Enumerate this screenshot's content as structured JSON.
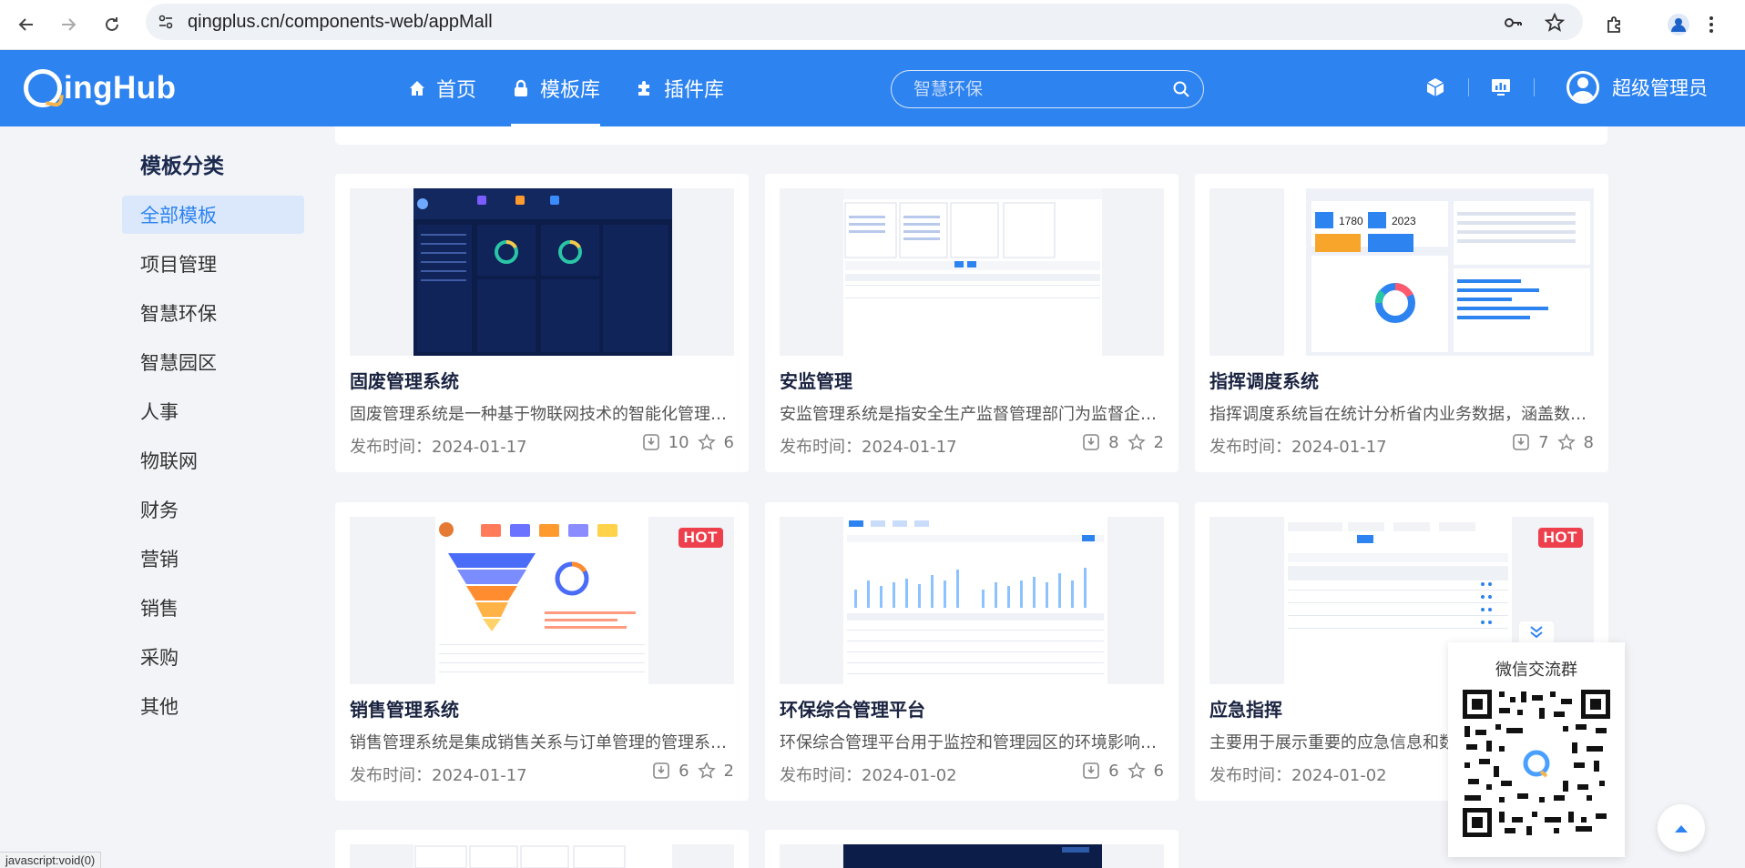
{
  "browser": {
    "url": "qingplus.cn/components-web/appMall"
  },
  "app": {
    "logo_text": "ingHub",
    "nav": [
      {
        "label": "首页",
        "icon": "home-icon"
      },
      {
        "label": "模板库",
        "icon": "lock-icon",
        "active": true
      },
      {
        "label": "插件库",
        "icon": "puzzle-icon"
      }
    ],
    "search_placeholder": "智慧环保",
    "username": "超级管理员"
  },
  "sidebar": {
    "title": "模板分类",
    "items": [
      {
        "label": "全部模板",
        "active": true
      },
      {
        "label": "项目管理"
      },
      {
        "label": "智慧环保"
      },
      {
        "label": "智慧园区"
      },
      {
        "label": "人事"
      },
      {
        "label": "物联网"
      },
      {
        "label": "财务"
      },
      {
        "label": "营销"
      },
      {
        "label": "销售"
      },
      {
        "label": "采购"
      },
      {
        "label": "其他"
      }
    ]
  },
  "cards": [
    {
      "title": "固废管理系统",
      "desc": "固废管理系统是一种基于物联网技术的智能化管理系统",
      "date": "发布时间：2024-01-17",
      "downloads": "10",
      "stars": "6",
      "hot": false,
      "theme": "dark"
    },
    {
      "title": "安监管理",
      "desc": "安监管理系统是指安全生产监督管理部门为监督企业安全生产",
      "date": "发布时间：2024-01-17",
      "downloads": "8",
      "stars": "2",
      "hot": false,
      "theme": "form"
    },
    {
      "title": "指挥调度系统",
      "desc": "指挥调度系统旨在统计分析省内业务数据，涵盖数据统计",
      "date": "发布时间：2024-01-17",
      "downloads": "7",
      "stars": "8",
      "hot": false,
      "theme": "dashboard"
    },
    {
      "title": "销售管理系统",
      "desc": "销售管理系统是集成销售关系与订单管理的管理系统平台",
      "date": "发布时间：2024-01-17",
      "downloads": "6",
      "stars": "2",
      "hot": true,
      "hot_label": "HOT",
      "theme": "funnel"
    },
    {
      "title": "环保综合管理平台",
      "desc": "环保综合管理平台用于监控和管理园区的环境影响因素",
      "date": "发布时间：2024-01-02",
      "downloads": "6",
      "stars": "6",
      "hot": false,
      "theme": "bars"
    },
    {
      "title": "应急指挥",
      "desc": "主要用于展示重要的应急信息和数据",
      "date": "发布时间：2024-01-02",
      "downloads": "",
      "stars": "",
      "hot": true,
      "hot_label": "HOT",
      "theme": "table"
    }
  ],
  "qr": {
    "title": "微信交流群"
  },
  "status_bar": "javascript:void(0)"
}
